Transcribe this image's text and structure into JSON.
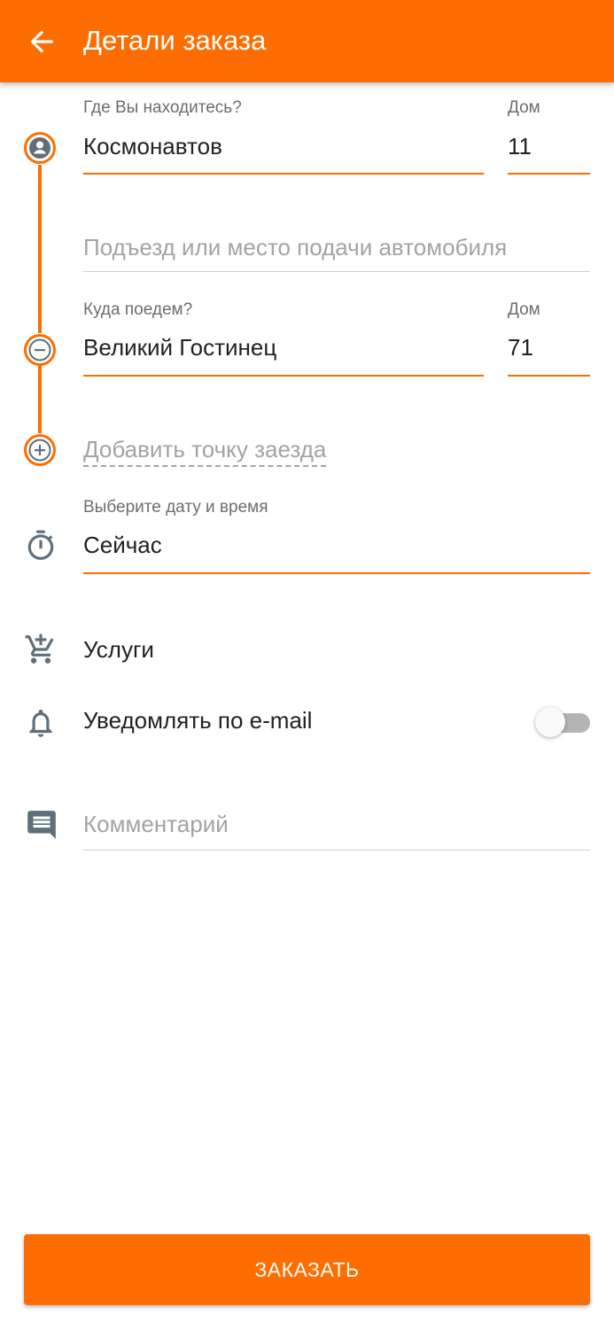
{
  "appbar": {
    "title": "Детали заказа",
    "back_icon": "arrow-back-icon"
  },
  "pickup": {
    "label": "Где Вы находитесь?",
    "street": "Космонавтов",
    "house_label": "Дом",
    "house": "11",
    "icon": "person-circle-icon"
  },
  "entrance": {
    "placeholder": "Подъезд или место подачи автомобиля"
  },
  "destination": {
    "label": "Куда поедем?",
    "street": "Великий Гостинец",
    "house_label": "Дом",
    "house": "71",
    "icon": "remove-circle-icon"
  },
  "add_stop": {
    "label": "Добавить точку заезда",
    "icon": "add-circle-icon"
  },
  "datetime": {
    "label": "Выберите дату и время",
    "value": "Сейчас",
    "icon": "timer-icon"
  },
  "services": {
    "label": "Услуги",
    "icon": "add-cart-icon"
  },
  "email_notify": {
    "label": "Уведомлять по e-mail",
    "enabled": false,
    "icon": "bell-icon"
  },
  "comment": {
    "placeholder": "Комментарий",
    "icon": "comment-icon"
  },
  "order_button": {
    "label": "ЗАКАЗАТЬ"
  },
  "colors": {
    "accent": "#ff6d00",
    "icon_gray": "#5f6f7a",
    "placeholder": "#a3a3a3"
  }
}
